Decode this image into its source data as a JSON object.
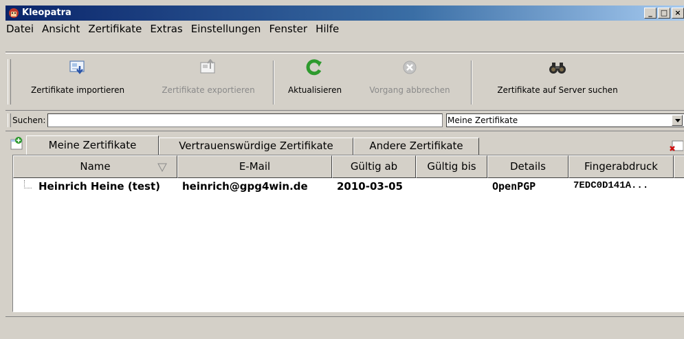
{
  "window": {
    "title": "Kleopatra",
    "minimize_label": "_",
    "maximize_label": "□",
    "close_label": "×"
  },
  "menu": [
    {
      "label": "Datei"
    },
    {
      "label": "Ansicht"
    },
    {
      "label": "Zertifikate"
    },
    {
      "label": "Extras"
    },
    {
      "label": "Einstellungen"
    },
    {
      "label": "Fenster"
    },
    {
      "label": "Hilfe"
    }
  ],
  "toolbar": {
    "import_label": "Zertifikate importieren",
    "export_label": "Zertifikate exportieren",
    "refresh_label": "Aktualisieren",
    "cancel_label": "Vorgang abbrechen",
    "server_search_label": "Zertifikate auf Server suchen"
  },
  "search": {
    "label": "Suchen:",
    "value": "",
    "filter_value": "Meine Zertifikate"
  },
  "tabs": [
    {
      "label": "Meine Zertifikate",
      "active": true
    },
    {
      "label": "Vertrauenswürdige Zertifikate",
      "active": false
    },
    {
      "label": "Andere Zertifikate",
      "active": false
    }
  ],
  "table": {
    "columns": [
      "Name",
      "E-Mail",
      "Gültig ab",
      "Gültig bis",
      "Details",
      "Fingerabdruck"
    ],
    "rows": [
      {
        "name": "Heinrich Heine (test)",
        "email": "heinrich@gpg4win.de",
        "valid_from": "2010-03-05",
        "valid_until": "",
        "details": "OpenPGP",
        "fingerprint": "7EDC0D141A..."
      }
    ]
  },
  "colors": {
    "titlebar_start": "#0a246a",
    "titlebar_end": "#a6caf0",
    "window_bg": "#d4d0c8",
    "refresh_green": "#2e9a2e"
  }
}
